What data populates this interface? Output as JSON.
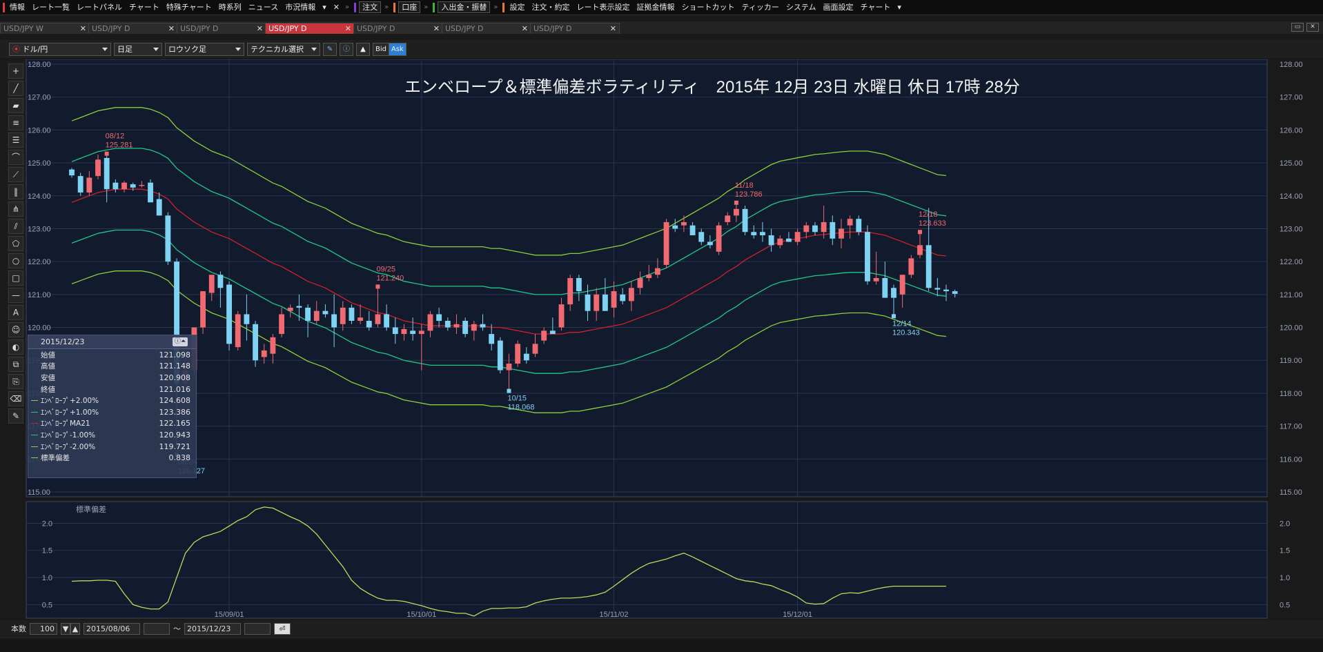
{
  "menu": {
    "groups": [
      {
        "color": "#e63c3c",
        "items": [
          "情報",
          "レート一覧",
          "レートパネル",
          "チャート",
          "特殊チャート",
          "時系列",
          "ニュース",
          "市況情報"
        ]
      },
      {
        "color": "#8c3cd6",
        "items": [
          "注文"
        ]
      },
      {
        "color": "#e6783c",
        "items": [
          "口座"
        ]
      },
      {
        "color": "#3cb43c",
        "items": [
          "入出金・振替"
        ]
      },
      {
        "color": "#e6783c",
        "items": [
          "設定",
          "注文・約定",
          "レート表示設定",
          "証拠金情報",
          "ショートカット",
          "ティッカー",
          "システム",
          "画面設定",
          "チャート"
        ]
      }
    ]
  },
  "tabs": [
    {
      "label": "USD/JPY W"
    },
    {
      "label": "USD/JPY D"
    },
    {
      "label": "USD/JPY D"
    },
    {
      "label": "USD/JPY D",
      "active": true
    },
    {
      "label": "USD/JPY D"
    },
    {
      "label": "USD/JPY D"
    },
    {
      "label": "USD/JPY D"
    }
  ],
  "toolbar": {
    "pair": "ドル/円",
    "period": "日足",
    "chart_type": "ロウソク足",
    "technical": "テクニカル選択",
    "bid": "Bid",
    "ask": "Ask"
  },
  "chart_title": "エンベロープ＆標準偏差ボラティリティ　2015年 12月 23日 水曜日 休日 17時 28分",
  "info": {
    "date": "2015/12/23",
    "rows": [
      {
        "label": "始値",
        "value": "121.098",
        "color": ""
      },
      {
        "label": "高値",
        "value": "121.148",
        "color": ""
      },
      {
        "label": "安値",
        "value": "120.908",
        "color": ""
      },
      {
        "label": "終値",
        "value": "121.016",
        "color": ""
      },
      {
        "label": "ｴﾝﾍﾞﾛｰﾌﾟ+2.00%",
        "value": "124.608",
        "color": "#8ccf3a"
      },
      {
        "label": "ｴﾝﾍﾞﾛｰﾌﾟ+1.00%",
        "value": "123.386",
        "color": "#1ec98c"
      },
      {
        "label": "ｴﾝﾍﾞﾛｰﾌﾟMA21",
        "value": "122.165",
        "color": "#d0202a"
      },
      {
        "label": "ｴﾝﾍﾞﾛｰﾌﾟ-1.00%",
        "value": "120.943",
        "color": "#1ec98c"
      },
      {
        "label": "ｴﾝﾍﾞﾛｰﾌﾟ-2.00%",
        "value": "119.721",
        "color": "#8ccf3a"
      },
      {
        "label": "標準偏差",
        "value": "0.838",
        "color": "#8ccf3a"
      }
    ]
  },
  "subchart_label": "標準偏差",
  "bottom": {
    "count_label": "本数",
    "count": "100",
    "from": "2015/08/06",
    "tilde": "〜",
    "to": "2015/12/23"
  },
  "chart_data": {
    "type": "candlestick",
    "y_main_range": [
      115,
      128
    ],
    "y_main_ticks": [
      "128.00",
      "127.00",
      "126.00",
      "125.00",
      "124.00",
      "123.00",
      "122.00",
      "121.00",
      "120.00",
      "119.00",
      "118.00",
      "117.00",
      "116.00",
      "115.00"
    ],
    "y_sub_range": [
      0.25,
      2.4
    ],
    "y_sub_ticks": [
      "2.0",
      "1.5",
      "1.0",
      "0.5"
    ],
    "x_labels": [
      {
        "label": "15/09/01",
        "i": 18
      },
      {
        "label": "15/10/01",
        "i": 40
      },
      {
        "label": "15/11/02",
        "i": 62
      },
      {
        "label": "15/12/01",
        "i": 83
      }
    ],
    "candles": [
      [
        124.8,
        124.85,
        124.55,
        124.62
      ],
      [
        124.6,
        124.7,
        124.0,
        124.1
      ],
      [
        124.1,
        124.75,
        124.0,
        124.55
      ],
      [
        124.6,
        125.25,
        124.5,
        125.1
      ],
      [
        125.15,
        125.28,
        123.8,
        124.2
      ],
      [
        124.4,
        124.5,
        124.1,
        124.2
      ],
      [
        124.2,
        124.45,
        124.1,
        124.4
      ],
      [
        124.35,
        124.4,
        124.15,
        124.25
      ],
      [
        124.3,
        124.45,
        124.25,
        124.33
      ],
      [
        124.4,
        124.5,
        123.9,
        123.8
      ],
      [
        123.9,
        124.1,
        123.4,
        123.4
      ],
      [
        123.4,
        123.5,
        121.9,
        122.0
      ],
      [
        122.0,
        122.1,
        116.13,
        118.3
      ],
      [
        118.3,
        119.2,
        118.2,
        118.7
      ],
      [
        118.7,
        120.0,
        118.5,
        120.0
      ],
      [
        120.0,
        121.1,
        119.8,
        121.1
      ],
      [
        121.05,
        121.6,
        120.8,
        121.6
      ],
      [
        121.6,
        121.7,
        120.6,
        121.2
      ],
      [
        121.3,
        121.4,
        119.3,
        119.5
      ],
      [
        119.4,
        120.5,
        119.3,
        120.4
      ],
      [
        120.4,
        121.0,
        119.6,
        120.1
      ],
      [
        120.1,
        120.2,
        118.8,
        119.0
      ],
      [
        119.1,
        119.5,
        118.9,
        119.3
      ],
      [
        119.2,
        119.8,
        118.9,
        119.7
      ],
      [
        119.8,
        120.6,
        119.7,
        120.4
      ],
      [
        120.5,
        120.7,
        120.3,
        120.6
      ],
      [
        120.65,
        121.0,
        120.2,
        120.6
      ],
      [
        120.6,
        120.7,
        119.7,
        120.2
      ],
      [
        120.2,
        120.8,
        120.1,
        120.5
      ],
      [
        120.5,
        120.7,
        120.3,
        120.4
      ],
      [
        120.4,
        121.0,
        119.4,
        120.0
      ],
      [
        120.1,
        120.8,
        119.9,
        120.6
      ],
      [
        120.6,
        120.7,
        120.1,
        120.2
      ],
      [
        120.2,
        120.7,
        120.1,
        120.3
      ],
      [
        120.2,
        120.5,
        119.9,
        120.0
      ],
      [
        120.1,
        121.24,
        120.0,
        120.4
      ],
      [
        120.4,
        120.7,
        119.9,
        120.0
      ],
      [
        120.0,
        120.3,
        119.5,
        119.8
      ],
      [
        119.8,
        120.1,
        119.6,
        119.95
      ],
      [
        119.9,
        120.3,
        119.6,
        119.8
      ],
      [
        119.8,
        120.1,
        118.7,
        119.9
      ],
      [
        119.9,
        120.5,
        119.7,
        120.4
      ],
      [
        120.4,
        120.6,
        120.0,
        120.2
      ],
      [
        120.2,
        120.3,
        119.9,
        120.0
      ],
      [
        120.0,
        120.4,
        119.8,
        120.1
      ],
      [
        120.2,
        120.3,
        119.7,
        119.8
      ],
      [
        119.9,
        120.2,
        119.6,
        120.1
      ],
      [
        120.1,
        120.4,
        119.9,
        120.0
      ],
      [
        119.8,
        120.1,
        119.3,
        119.5
      ],
      [
        119.6,
        119.7,
        118.6,
        118.7
      ],
      [
        118.7,
        119.2,
        118.07,
        118.9
      ],
      [
        118.9,
        119.6,
        118.8,
        119.5
      ],
      [
        119.2,
        119.4,
        118.9,
        119.0
      ],
      [
        119.2,
        119.8,
        119.1,
        119.5
      ],
      [
        119.6,
        120.0,
        119.5,
        119.9
      ],
      [
        119.9,
        120.3,
        119.8,
        119.8
      ],
      [
        120.0,
        120.9,
        119.9,
        120.7
      ],
      [
        120.7,
        121.6,
        120.5,
        121.5
      ],
      [
        121.5,
        121.6,
        120.8,
        121.1
      ],
      [
        121.0,
        121.3,
        120.2,
        120.5
      ],
      [
        120.5,
        121.2,
        120.2,
        121.0
      ],
      [
        121.0,
        121.5,
        120.7,
        120.5
      ],
      [
        120.6,
        121.4,
        120.3,
        121.1
      ],
      [
        121.0,
        121.2,
        120.7,
        120.8
      ],
      [
        120.8,
        121.4,
        120.5,
        121.2
      ],
      [
        121.2,
        121.7,
        121.0,
        121.5
      ],
      [
        121.5,
        121.9,
        121.4,
        121.6
      ],
      [
        121.6,
        122.1,
        121.5,
        121.8
      ],
      [
        121.9,
        123.3,
        121.8,
        123.2
      ],
      [
        123.1,
        123.3,
        122.9,
        123.0
      ],
      [
        123.1,
        123.4,
        122.9,
        123.2
      ],
      [
        123.1,
        123.2,
        122.8,
        122.8
      ],
      [
        122.9,
        123.0,
        122.5,
        122.6
      ],
      [
        122.6,
        122.8,
        122.4,
        122.5
      ],
      [
        122.3,
        123.2,
        122.2,
        123.1
      ],
      [
        123.2,
        123.5,
        123.1,
        123.4
      ],
      [
        123.4,
        123.79,
        123.2,
        123.6
      ],
      [
        123.6,
        123.7,
        122.8,
        122.9
      ],
      [
        122.9,
        123.1,
        122.7,
        122.8
      ],
      [
        122.9,
        123.2,
        122.6,
        122.8
      ],
      [
        122.8,
        123.0,
        122.3,
        122.5
      ],
      [
        122.5,
        122.8,
        122.4,
        122.7
      ],
      [
        122.7,
        122.9,
        122.6,
        122.6
      ],
      [
        122.6,
        123.0,
        122.5,
        122.9
      ],
      [
        122.9,
        123.2,
        122.7,
        123.1
      ],
      [
        123.1,
        123.2,
        122.8,
        122.9
      ],
      [
        122.9,
        123.7,
        122.7,
        123.2
      ],
      [
        123.2,
        123.4,
        122.5,
        122.7
      ],
      [
        122.7,
        123.3,
        122.4,
        123.0
      ],
      [
        123.1,
        123.4,
        122.7,
        123.3
      ],
      [
        123.3,
        123.4,
        122.8,
        122.9
      ],
      [
        122.9,
        123.1,
        121.3,
        121.4
      ],
      [
        121.4,
        122.3,
        121.3,
        121.5
      ],
      [
        121.5,
        122.0,
        120.9,
        120.9
      ],
      [
        121.2,
        121.3,
        120.34,
        120.9
      ],
      [
        121.0,
        121.6,
        120.6,
        121.6
      ],
      [
        121.6,
        122.2,
        121.5,
        122.1
      ],
      [
        122.2,
        122.9,
        122.1,
        122.5
      ],
      [
        122.5,
        123.63,
        121.1,
        121.2
      ],
      [
        121.2,
        121.5,
        120.95,
        121.15
      ],
      [
        121.15,
        121.3,
        120.8,
        121.1
      ],
      [
        121.1,
        121.15,
        120.91,
        121.02
      ]
    ],
    "ma21": [
      123.8,
      123.9,
      124.0,
      124.1,
      124.15,
      124.2,
      124.2,
      124.2,
      124.2,
      124.15,
      124.05,
      123.9,
      123.6,
      123.4,
      123.2,
      123.05,
      122.9,
      122.8,
      122.7,
      122.55,
      122.4,
      122.25,
      122.1,
      121.95,
      121.85,
      121.7,
      121.55,
      121.4,
      121.3,
      121.2,
      121.05,
      120.9,
      120.75,
      120.65,
      120.55,
      120.45,
      120.4,
      120.3,
      120.2,
      120.15,
      120.1,
      120.05,
      120.05,
      120.05,
      120.05,
      120.05,
      120.05,
      120.05,
      120.0,
      120.0,
      119.95,
      119.9,
      119.85,
      119.8,
      119.8,
      119.8,
      119.8,
      119.85,
      119.85,
      119.9,
      119.95,
      120.0,
      120.05,
      120.1,
      120.2,
      120.3,
      120.4,
      120.5,
      120.6,
      120.75,
      120.9,
      121.05,
      121.2,
      121.35,
      121.5,
      121.7,
      121.85,
      122.05,
      122.2,
      122.35,
      122.5,
      122.6,
      122.65,
      122.7,
      122.75,
      122.8,
      122.82,
      122.85,
      122.88,
      122.9,
      122.9,
      122.9,
      122.85,
      122.8,
      122.7,
      122.6,
      122.5,
      122.4,
      122.3,
      122.2,
      122.17
    ],
    "std": [
      0.93,
      0.94,
      0.94,
      0.95,
      0.95,
      0.93,
      0.7,
      0.5,
      0.45,
      0.42,
      0.42,
      0.55,
      1.0,
      1.45,
      1.65,
      1.75,
      1.8,
      1.85,
      1.95,
      2.05,
      2.12,
      2.25,
      2.3,
      2.28,
      2.2,
      2.12,
      2.05,
      1.95,
      1.8,
      1.6,
      1.4,
      1.2,
      0.95,
      0.8,
      0.7,
      0.62,
      0.58,
      0.58,
      0.56,
      0.52,
      0.48,
      0.43,
      0.39,
      0.37,
      0.34,
      0.34,
      0.29,
      0.38,
      0.43,
      0.43,
      0.44,
      0.44,
      0.46,
      0.53,
      0.57,
      0.6,
      0.62,
      0.62,
      0.63,
      0.65,
      0.68,
      0.73,
      0.84,
      0.96,
      1.08,
      1.18,
      1.26,
      1.3,
      1.34,
      1.4,
      1.45,
      1.38,
      1.3,
      1.22,
      1.14,
      1.06,
      0.98,
      0.94,
      0.92,
      0.88,
      0.85,
      0.78,
      0.72,
      0.64,
      0.53,
      0.51,
      0.52,
      0.62,
      0.7,
      0.72,
      0.71,
      0.75,
      0.79,
      0.82,
      0.84,
      0.84,
      0.84,
      0.84,
      0.84,
      0.84,
      0.84
    ],
    "env_pct": [
      2,
      1,
      -1,
      -2
    ],
    "annotations": [
      {
        "i": 4,
        "date": "08/12",
        "price": "125.281",
        "dir": "up"
      },
      {
        "i": 12,
        "date": "08/24",
        "price": "116.127",
        "dir": "down"
      },
      {
        "i": 35,
        "date": "09/25",
        "price": "121.240",
        "dir": "up"
      },
      {
        "i": 50,
        "date": "10/15",
        "price": "118.068",
        "dir": "down"
      },
      {
        "i": 76,
        "date": "11/18",
        "price": "123.786",
        "dir": "up"
      },
      {
        "i": 94,
        "date": "12/14",
        "price": "120.343",
        "dir": "down"
      },
      {
        "i": 97,
        "date": "12/18",
        "price": "123.633",
        "dir": "up"
      }
    ],
    "colors": {
      "up": "#f06a72",
      "down": "#7fd3f2",
      "ma": "#d0202a",
      "env1": "#1ec98c",
      "env2": "#8ccf3a",
      "std": "#b6e05a",
      "bg": "#121a2e",
      "grid": "#2a3552",
      "axis": "#9aa3b5"
    }
  }
}
